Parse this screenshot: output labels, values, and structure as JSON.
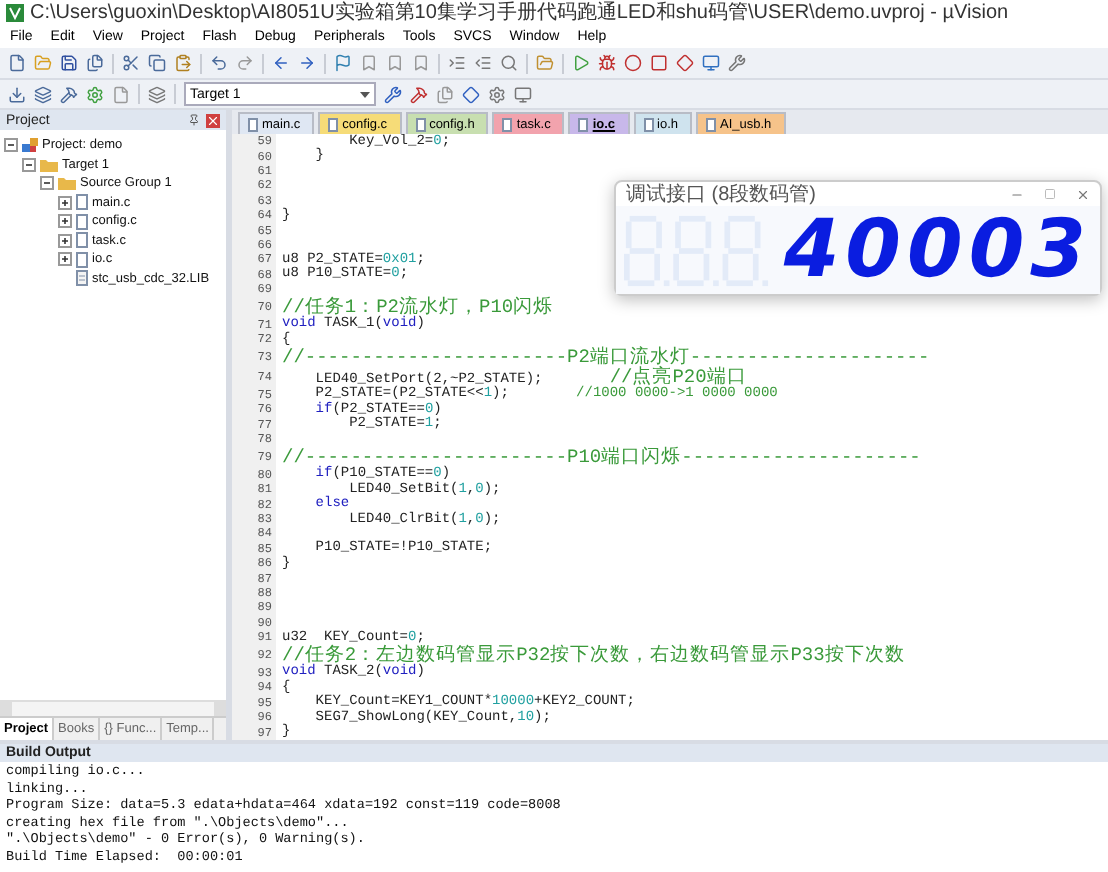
{
  "window": {
    "title": "C:\\Users\\guoxin\\Desktop\\AI8051U实验箱第10集学习手册代码跑通LED和shu码管\\USER\\demo.uvproj - µVision"
  },
  "menu": [
    "File",
    "Edit",
    "View",
    "Project",
    "Flash",
    "Debug",
    "Peripherals",
    "Tools",
    "SVCS",
    "Window",
    "Help"
  ],
  "target_select": {
    "value": "Target 1"
  },
  "project_panel": {
    "title": "Project",
    "tree": [
      {
        "label": "Project: demo",
        "kind": "project",
        "expanded": true,
        "children": [
          {
            "label": "Target 1",
            "kind": "folder",
            "expanded": true,
            "children": [
              {
                "label": "Source Group 1",
                "kind": "folder",
                "expanded": true,
                "children": [
                  {
                    "label": "main.c",
                    "kind": "file",
                    "expanded": false
                  },
                  {
                    "label": "config.c",
                    "kind": "file",
                    "expanded": false
                  },
                  {
                    "label": "task.c",
                    "kind": "file",
                    "expanded": false
                  },
                  {
                    "label": "io.c",
                    "kind": "file",
                    "expanded": false
                  },
                  {
                    "label": "stc_usb_cdc_32.LIB",
                    "kind": "lib"
                  }
                ]
              }
            ]
          }
        ]
      }
    ],
    "tabs": [
      {
        "label": "Project",
        "selected": true
      },
      {
        "label": "Books",
        "selected": false
      },
      {
        "label": "{} Func...",
        "selected": false
      },
      {
        "label": "Temp...",
        "selected": false
      }
    ]
  },
  "editor_tabs": [
    {
      "label": "main.c",
      "color": "#dfe7f3",
      "selected": false
    },
    {
      "label": "config.c",
      "color": "#f6dc78",
      "selected": false
    },
    {
      "label": "config.h",
      "color": "#c8dfb0",
      "selected": false
    },
    {
      "label": "task.c",
      "color": "#f2a3ad",
      "selected": false
    },
    {
      "label": "io.c",
      "color": "#c8b8ea",
      "selected": true
    },
    {
      "label": "io.h",
      "color": "#cfe3ee",
      "selected": false
    },
    {
      "label": "AI_usb.h",
      "color": "#f6c38a",
      "selected": false
    }
  ],
  "code_lines": [
    {
      "no": "59",
      "parts": [
        {
          "kind": "plain",
          "text": "        Key_Vol_2="
        },
        {
          "kind": "number",
          "text": "0"
        },
        {
          "kind": "plain",
          "text": ";"
        }
      ]
    },
    {
      "no": "60",
      "parts": [
        {
          "kind": "plain",
          "text": "    }"
        }
      ]
    },
    {
      "no": "61"
    },
    {
      "no": "62"
    },
    {
      "no": "63"
    },
    {
      "no": "64",
      "parts": [
        {
          "kind": "plain",
          "text": "}"
        }
      ]
    },
    {
      "no": "65"
    },
    {
      "no": "66"
    },
    {
      "no": "67",
      "parts": [
        {
          "kind": "plain",
          "text": "u8 P2_STATE="
        },
        {
          "kind": "number",
          "text": "0x01"
        },
        {
          "kind": "plain",
          "text": ";"
        }
      ]
    },
    {
      "no": "68",
      "parts": [
        {
          "kind": "plain",
          "text": "u8 P10_STATE="
        },
        {
          "kind": "number",
          "text": "0"
        },
        {
          "kind": "plain",
          "text": ";"
        }
      ]
    },
    {
      "no": "69"
    },
    {
      "no": "70",
      "parts": [
        {
          "kind": "comment",
          "text": "//任务1：P2流水灯，P10闪烁"
        }
      ]
    },
    {
      "no": "71",
      "parts": [
        {
          "kind": "keyword",
          "text": "void"
        },
        {
          "kind": "plain",
          "text": " TASK_1("
        },
        {
          "kind": "keyword",
          "text": "void"
        },
        {
          "kind": "plain",
          "text": ")"
        }
      ]
    },
    {
      "no": "72",
      "parts": [
        {
          "kind": "plain",
          "text": "{"
        }
      ]
    },
    {
      "no": "73",
      "parts": [
        {
          "kind": "comment",
          "text": "//-----------------------P2端口流水灯---------------------"
        }
      ]
    },
    {
      "no": "74",
      "parts": [
        {
          "kind": "plain",
          "text": "    LED40_SetPort(2,~P2_STATE);        "
        },
        {
          "kind": "comment",
          "text": "//点亮P20端口"
        }
      ]
    },
    {
      "no": "75",
      "parts": [
        {
          "kind": "plain",
          "text": "    P2_STATE=(P2_STATE<<"
        },
        {
          "kind": "number",
          "text": "1"
        },
        {
          "kind": "plain",
          "text": ");        "
        },
        {
          "kind": "comment",
          "text": "//1000 0000->1 0000 0000"
        }
      ]
    },
    {
      "no": "76",
      "parts": [
        {
          "kind": "keyword",
          "text": "    if"
        },
        {
          "kind": "plain",
          "text": "(P2_STATE=="
        },
        {
          "kind": "number",
          "text": "0"
        },
        {
          "kind": "plain",
          "text": ")"
        }
      ]
    },
    {
      "no": "77",
      "parts": [
        {
          "kind": "plain",
          "text": "        P2_STATE="
        },
        {
          "kind": "number",
          "text": "1"
        },
        {
          "kind": "plain",
          "text": ";"
        }
      ]
    },
    {
      "no": "78"
    },
    {
      "no": "79",
      "parts": [
        {
          "kind": "comment",
          "text": "//-----------------------P10端口闪烁---------------------"
        }
      ]
    },
    {
      "no": "80",
      "parts": [
        {
          "kind": "keyword",
          "text": "    if"
        },
        {
          "kind": "plain",
          "text": "(P10_STATE=="
        },
        {
          "kind": "number",
          "text": "0"
        },
        {
          "kind": "plain",
          "text": ")"
        }
      ]
    },
    {
      "no": "81",
      "parts": [
        {
          "kind": "plain",
          "text": "        LED40_SetBit("
        },
        {
          "kind": "number",
          "text": "1"
        },
        {
          "kind": "plain",
          "text": ","
        },
        {
          "kind": "number",
          "text": "0"
        },
        {
          "kind": "plain",
          "text": ");"
        }
      ]
    },
    {
      "no": "82",
      "parts": [
        {
          "kind": "keyword",
          "text": "    else"
        }
      ]
    },
    {
      "no": "83",
      "parts": [
        {
          "kind": "plain",
          "text": "        LED40_ClrBit("
        },
        {
          "kind": "number",
          "text": "1"
        },
        {
          "kind": "plain",
          "text": ","
        },
        {
          "kind": "number",
          "text": "0"
        },
        {
          "kind": "plain",
          "text": ");"
        }
      ]
    },
    {
      "no": "84"
    },
    {
      "no": "85",
      "parts": [
        {
          "kind": "plain",
          "text": "    P10_STATE=!P10_STATE;"
        }
      ]
    },
    {
      "no": "86",
      "parts": [
        {
          "kind": "plain",
          "text": "}"
        }
      ]
    },
    {
      "no": "87"
    },
    {
      "no": "88"
    },
    {
      "no": "89"
    },
    {
      "no": "90"
    },
    {
      "no": "91",
      "parts": [
        {
          "kind": "plain",
          "text": "u32  KEY_Count="
        },
        {
          "kind": "number",
          "text": "0"
        },
        {
          "kind": "plain",
          "text": ";"
        }
      ]
    },
    {
      "no": "92",
      "parts": [
        {
          "kind": "comment",
          "text": "//任务2：左边数码管显示P32按下次数，右边数码管显示P33按下次数"
        }
      ]
    },
    {
      "no": "93",
      "parts": [
        {
          "kind": "keyword",
          "text": "void"
        },
        {
          "kind": "plain",
          "text": " TASK_2("
        },
        {
          "kind": "keyword",
          "text": "void"
        },
        {
          "kind": "plain",
          "text": ")"
        }
      ]
    },
    {
      "no": "94",
      "parts": [
        {
          "kind": "plain",
          "text": "{"
        }
      ]
    },
    {
      "no": "95",
      "parts": [
        {
          "kind": "plain",
          "text": "    KEY_Count=KEY1_COUNT*"
        },
        {
          "kind": "number",
          "text": "10000"
        },
        {
          "kind": "plain",
          "text": "+KEY2_COUNT;"
        }
      ]
    },
    {
      "no": "96",
      "parts": [
        {
          "kind": "plain",
          "text": "    SEG7_ShowLong(KEY_Count,"
        },
        {
          "kind": "number",
          "text": "10"
        },
        {
          "kind": "plain",
          "text": ");"
        }
      ]
    },
    {
      "no": "97",
      "parts": [
        {
          "kind": "plain",
          "text": "}"
        }
      ]
    }
  ],
  "popup": {
    "title": "调试接口 (8段数码管)",
    "display": "40003"
  },
  "build_output": {
    "title": "Build Output",
    "lines": [
      "compiling io.c...",
      "linking...",
      "Program Size: data=5.3 edata+hdata=464 xdata=192 const=119 code=8008",
      "creating hex file from \".\\Objects\\demo\"...",
      "\".\\Objects\\demo\" - 0 Error(s), 0 Warning(s).",
      "Build Time Elapsed:  00:00:01"
    ]
  }
}
